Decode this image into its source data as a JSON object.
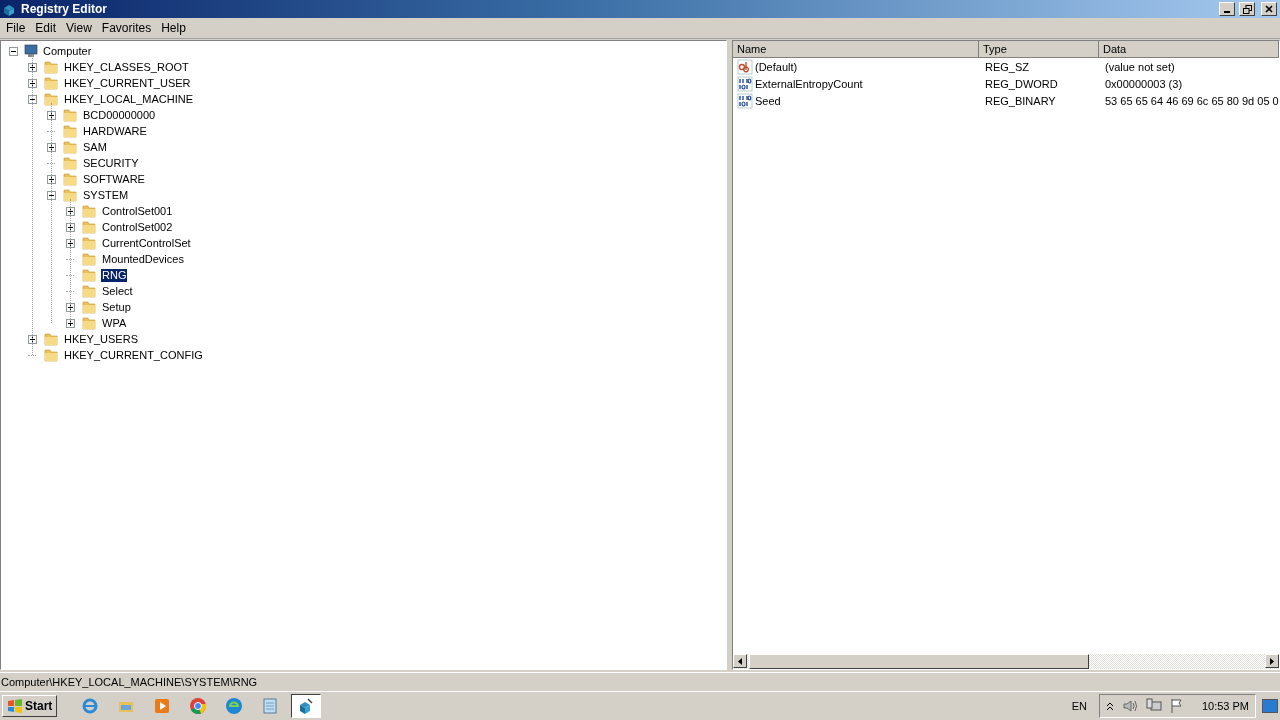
{
  "window": {
    "title": "Registry Editor"
  },
  "menu": [
    {
      "label": "File"
    },
    {
      "label": "Edit"
    },
    {
      "label": "View"
    },
    {
      "label": "Favorites"
    },
    {
      "label": "Help"
    }
  ],
  "tree": {
    "label": "Computer",
    "kind": "computer",
    "expanded": true,
    "selected": false,
    "children": [
      {
        "label": "HKEY_CLASSES_ROOT",
        "expanded": false,
        "selected": false
      },
      {
        "label": "HKEY_CURRENT_USER",
        "expanded": false,
        "selected": false
      },
      {
        "label": "HKEY_LOCAL_MACHINE",
        "expanded": true,
        "selected": false,
        "children": [
          {
            "label": "BCD00000000",
            "expanded": false,
            "selected": false
          },
          {
            "label": "HARDWARE",
            "selected": false
          },
          {
            "label": "SAM",
            "expanded": false,
            "selected": false
          },
          {
            "label": "SECURITY",
            "selected": false
          },
          {
            "label": "SOFTWARE",
            "expanded": false,
            "selected": false
          },
          {
            "label": "SYSTEM",
            "expanded": true,
            "selected": false,
            "children": [
              {
                "label": "ControlSet001",
                "expanded": false,
                "selected": false
              },
              {
                "label": "ControlSet002",
                "expanded": false,
                "selected": false
              },
              {
                "label": "CurrentControlSet",
                "expanded": false,
                "selected": false
              },
              {
                "label": "MountedDevices",
                "selected": false
              },
              {
                "label": "RNG",
                "selected": true
              },
              {
                "label": "Select",
                "selected": false
              },
              {
                "label": "Setup",
                "expanded": false,
                "selected": false
              },
              {
                "label": "WPA",
                "expanded": false,
                "selected": false
              }
            ]
          }
        ]
      },
      {
        "label": "HKEY_USERS",
        "expanded": false,
        "selected": false
      },
      {
        "label": "HKEY_CURRENT_CONFIG",
        "selected": false
      }
    ]
  },
  "values": {
    "columns": [
      "Name",
      "Type",
      "Data"
    ],
    "rows": [
      {
        "kind": "string",
        "name": "(Default)",
        "type": "REG_SZ",
        "data": "(value not set)"
      },
      {
        "kind": "binary",
        "name": "ExternalEntropyCount",
        "type": "REG_DWORD",
        "data": "0x00000003 (3)"
      },
      {
        "kind": "binary",
        "name": "Seed",
        "type": "REG_BINARY",
        "data": "53 65 65 64 46 69 6c 65 80 9d 05 0"
      }
    ]
  },
  "status_bar": "Computer\\HKEY_LOCAL_MACHINE\\SYSTEM\\RNG",
  "taskbar": {
    "start": "Start",
    "apps": [
      {
        "kind": "ie",
        "selected": false
      },
      {
        "kind": "folder",
        "selected": false
      },
      {
        "kind": "media",
        "selected": false
      },
      {
        "kind": "chrome",
        "selected": false
      },
      {
        "kind": "edge",
        "selected": false
      },
      {
        "kind": "notepad",
        "selected": false
      },
      {
        "kind": "regedit",
        "selected": true
      }
    ],
    "language": "EN",
    "clock": "10:53 PM"
  }
}
